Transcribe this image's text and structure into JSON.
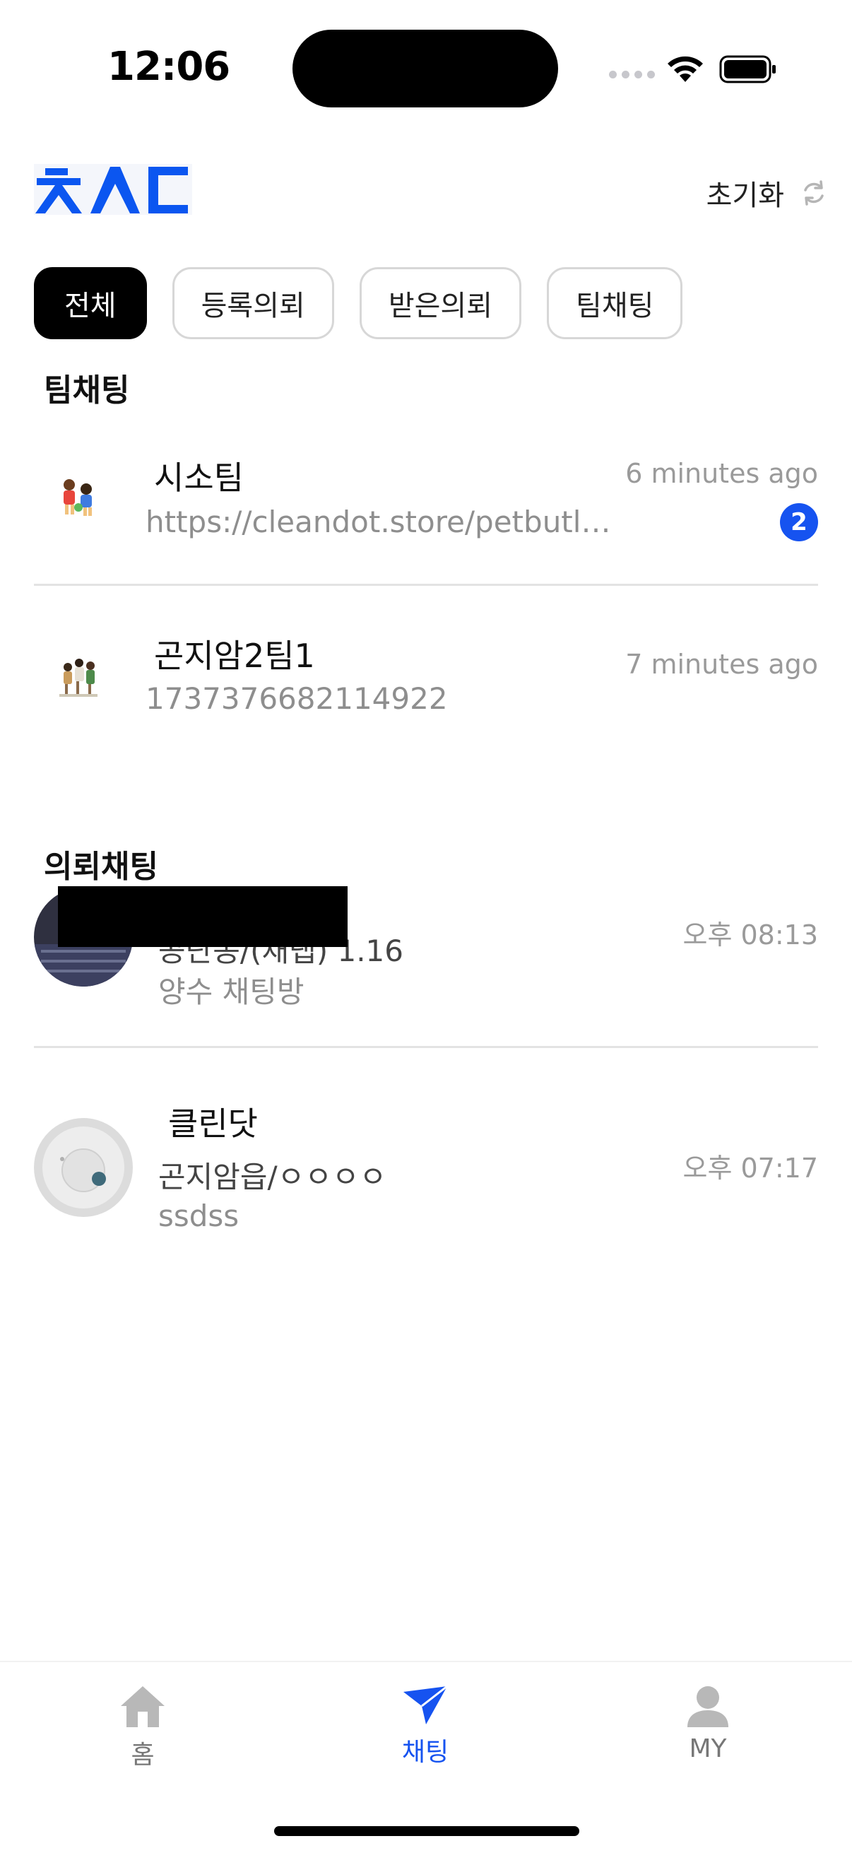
{
  "status_bar": {
    "time": "12:06"
  },
  "header": {
    "logo_text": "ㅊㅅㄷ",
    "reset_label": "초기화"
  },
  "tabs": [
    {
      "label": "전체",
      "active": true
    },
    {
      "label": "등록의뢰",
      "active": false
    },
    {
      "label": "받은의뢰",
      "active": false
    },
    {
      "label": "팀채팅",
      "active": false
    }
  ],
  "team_section": {
    "title": "팀채팅",
    "chats": [
      {
        "name": "시소팀",
        "preview": "https://cleandot.store/petbutl…",
        "time": "6 minutes ago",
        "unread": "2"
      },
      {
        "name": "곤지암2팀1",
        "preview": "1737376682114922",
        "time": "7 minutes ago"
      }
    ]
  },
  "request_section": {
    "title": "의뢰채팅",
    "chats": [
      {
        "name": "",
        "sub": "공단동/(채탭) 1.16",
        "preview": "양수 채팅방",
        "time": "오후 08:13"
      },
      {
        "name": "클린닷",
        "sub": "곤지암읍/ㅇㅇㅇㅇ",
        "preview": "ssdss",
        "time": "오후 07:17"
      }
    ]
  },
  "bottom_nav": [
    {
      "label": "홈",
      "icon": "home-icon",
      "active": false
    },
    {
      "label": "채팅",
      "icon": "send-icon",
      "active": true
    },
    {
      "label": "MY",
      "icon": "person-icon",
      "active": false
    }
  ],
  "colors": {
    "accent": "#1653f0",
    "logo": "#0b56f0",
    "badge": "#1653f0"
  }
}
